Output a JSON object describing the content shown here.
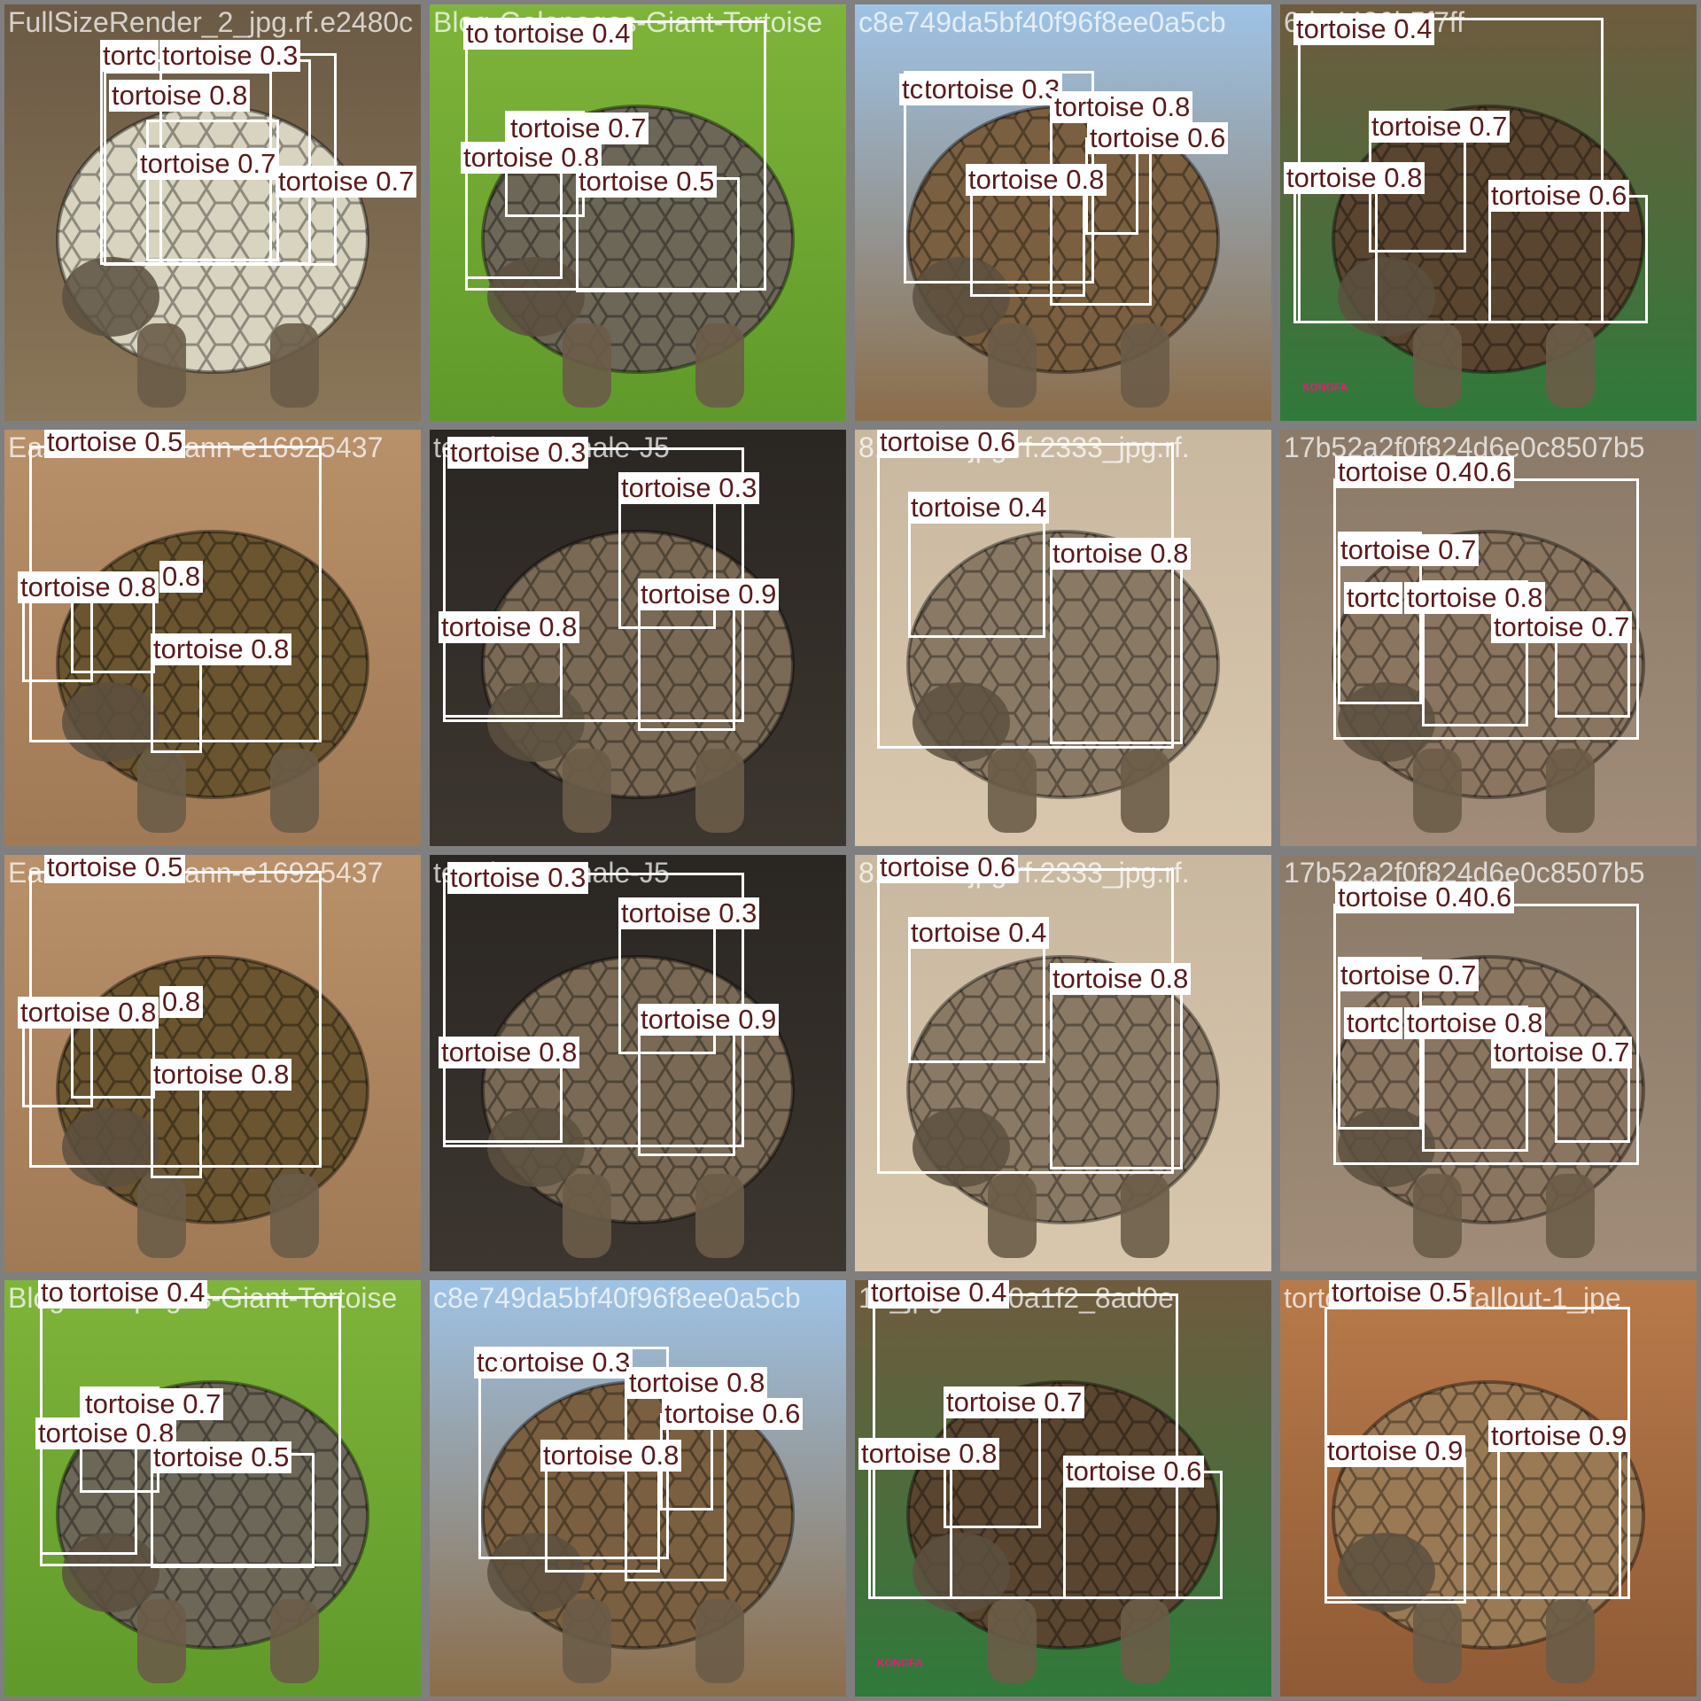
{
  "image": {
    "description_free": true,
    "class_name": "tortoise",
    "tile_filenames": [
      "FullSizeRender_2_jpg.rf.e2480c",
      "Blog-Galapagos-Giant-Tortoise",
      "c8e749da5bf40f96f8ee0a5cb",
      "6de4486b5f7ff",
      "Eastern-Hermann-e16925437",
      "tortoise-Female-J5",
      "8163663jpg.rf.2333_jpg.rf.",
      "17b52a2f0f824d6e0c8507b5",
      "Eastern-Hermann-e16925437",
      "tortoise-Female-J5",
      "8163663jpg.rf.2333_jpg.rf.",
      "17b52a2f0f824d6e0c8507b5",
      "Blog-Galapagos-Giant-Tortoise",
      "c8e749da5bf40f96f8ee0a5cb",
      "18_jpg.rf.da0a1f2_8ad0e",
      "tortoise-home-fallout-1_jpe"
    ],
    "tiles": [
      {
        "labels": [
          "tortoise 0.3",
          "tortoise 0.8",
          "tortoise 0.7",
          "tortoise 0.7",
          "tortc"
        ]
      },
      {
        "labels": [
          "tortoise 0.4",
          "tortoise 0.7",
          "tortoise 0.8",
          "tortoise 0.5",
          "to"
        ]
      },
      {
        "labels": [
          "tortoise 0.3",
          "tortoise 0.8",
          "tortoise 0.6",
          "tortoise 0.8",
          "tc"
        ]
      },
      {
        "labels": [
          "tortoise 0.4",
          "tortoise 0.7",
          "tortoise 0.8",
          "tortoise 0.6"
        ]
      },
      {
        "labels": [
          "tortoise 0.5",
          "tortoise 0.8",
          "tortoise 0.8",
          "0.8"
        ]
      },
      {
        "labels": [
          "tortoise 0.3",
          "tortoise 0.3",
          "tortoise 0.9",
          "tortoise 0.8"
        ]
      },
      {
        "labels": [
          "tortoise 0.6",
          "tortoise 0.4",
          "tortoise 0.8"
        ]
      },
      {
        "labels": [
          "tortoise 0.4",
          "0.6",
          "tortoise 0.7",
          "tortoise 0.8",
          "tortoise 0.7",
          "tortc"
        ]
      },
      {
        "labels": [
          "tortoise 0.5",
          "tortoise 0.8",
          "tortoise 0.8",
          "0.8"
        ]
      },
      {
        "labels": [
          "tortoise 0.3",
          "tortoise 0.3",
          "tortoise 0.9",
          "tortoise 0.8"
        ]
      },
      {
        "labels": [
          "tortoise 0.6",
          "tortoise 0.4",
          "tortoise 0.8"
        ]
      },
      {
        "labels": [
          "tortoise 0.4",
          "0.6",
          "tortoise 0.7",
          "tortoise 0.8",
          "tortoise 0.7",
          "tortc"
        ]
      },
      {
        "labels": [
          "tortoise 0.4",
          "tortoise 0.7",
          "tortoise 0.8",
          "tortoise 0.5",
          "to"
        ]
      },
      {
        "labels": [
          "tortoise 0.3",
          "tortoise 0.8",
          "tortoise 0.6",
          "tortoise 0.8",
          "tc"
        ]
      },
      {
        "labels": [
          "tortoise 0.4",
          "tortoise 0.7",
          "tortoise 0.8",
          "tortoise 0.6"
        ]
      },
      {
        "labels": [
          "tortoise 0.5",
          "tortoise 0.9",
          "tortoise 0.9"
        ]
      }
    ],
    "watermark_text": "KONGFA",
    "colors": {
      "box": "#ffffff",
      "label_text": "#5a1a1a",
      "grid_border": "#7f7f7f"
    }
  }
}
